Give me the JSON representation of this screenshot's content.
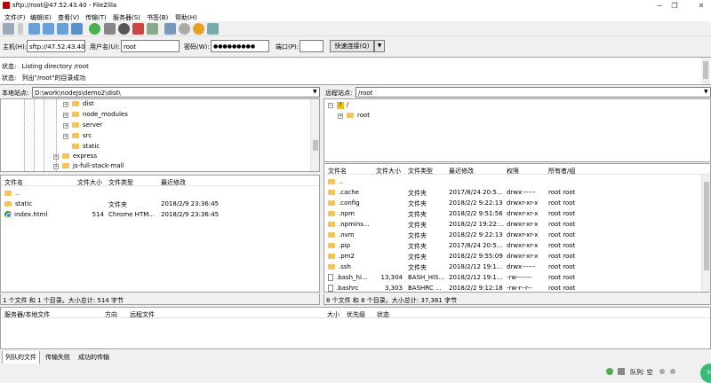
{
  "window": {
    "title": "sftp://root@47.52.43.40 - FileZilla"
  },
  "menu": [
    "文件(F)",
    "编辑(E)",
    "查看(V)",
    "传输(T)",
    "服务器(S)",
    "书签(B)",
    "帮助(H)"
  ],
  "quickconnect": {
    "host_label": "主机(H):",
    "host_value": "sftp://47.52.43.40",
    "user_label": "用户名(U):",
    "user_value": "root",
    "pass_label": "密码(W):",
    "pass_value": "●●●●●●●●●",
    "port_label": "端口(P):",
    "port_value": "",
    "button": "快速连接(Q)",
    "dropdown": "▼"
  },
  "log": [
    {
      "label": "状态:",
      "text": "Listing directory /root"
    },
    {
      "label": "状态:",
      "text": "列出\"/root\"的目录成功"
    }
  ],
  "local": {
    "site_label": "本地站点:",
    "path": "D:\\work\\nodeJs\\demo2\\dist\\",
    "tree": [
      "dist",
      "node_modules",
      "server",
      "src",
      "static",
      "express",
      "js-full-stack-mall"
    ],
    "columns": [
      "文件名",
      "文件大小",
      "文件类型",
      "最近修改"
    ],
    "files": [
      {
        "name": "..",
        "size": "",
        "type": "",
        "modified": ""
      },
      {
        "name": "static",
        "size": "",
        "type": "文件夹",
        "modified": "2018/2/9 23:36:45"
      },
      {
        "name": "index.html",
        "size": "514",
        "type": "Chrome HTM...",
        "modified": "2018/2/9 23:36:45"
      }
    ],
    "status": "1 个文件 和 1 个目录。大小总计: 514 字节"
  },
  "remote": {
    "site_label": "远程站点:",
    "path": "/root",
    "tree": [
      "/",
      "root"
    ],
    "columns": [
      "文件名",
      "文件大小",
      "文件类型",
      "最近修改",
      "权限",
      "所有者/组"
    ],
    "files": [
      {
        "name": "..",
        "size": "",
        "type": "",
        "modified": "",
        "perm": "",
        "owner": ""
      },
      {
        "name": ".cache",
        "size": "",
        "type": "文件夹",
        "modified": "2017/8/24 20:5...",
        "perm": "drwx------",
        "owner": "root root"
      },
      {
        "name": ".config",
        "size": "",
        "type": "文件夹",
        "modified": "2018/2/2 9:22:13",
        "perm": "drwxr-xr-x",
        "owner": "root root"
      },
      {
        "name": ".npm",
        "size": "",
        "type": "文件夹",
        "modified": "2018/2/2 9:51:56",
        "perm": "drwxr-xr-x",
        "owner": "root root"
      },
      {
        "name": ".npmins...",
        "size": "",
        "type": "文件夹",
        "modified": "2018/2/2 19:22:...",
        "perm": "drwxr-xr-x",
        "owner": "root root"
      },
      {
        "name": ".nvm",
        "size": "",
        "type": "文件夹",
        "modified": "2018/2/2 9:22:13",
        "perm": "drwxr-xr-x",
        "owner": "root root"
      },
      {
        "name": ".pip",
        "size": "",
        "type": "文件夹",
        "modified": "2017/8/24 20:5...",
        "perm": "drwxr-xr-x",
        "owner": "root root"
      },
      {
        "name": ".pm2",
        "size": "",
        "type": "文件夹",
        "modified": "2018/2/2 9:55:09",
        "perm": "drwxr-xr-x",
        "owner": "root root"
      },
      {
        "name": ".ssh",
        "size": "",
        "type": "文件夹",
        "modified": "2018/2/12 19:1...",
        "perm": "drwx------",
        "owner": "root root"
      },
      {
        "name": ".bash_hi...",
        "size": "13,304",
        "type": "BASH_HIS...",
        "modified": "2018/2/12 19:1...",
        "perm": "-rw-------",
        "owner": "root root"
      },
      {
        "name": ".bashrc",
        "size": "3,303",
        "type": "BASHRC ...",
        "modified": "2018/2/2 9:12:18",
        "perm": "-rw-r--r--",
        "owner": "root root"
      }
    ],
    "status": "8 个文件 和 8 个目录。大小总计: 37,361 字节"
  },
  "queue": {
    "columns": [
      "服务器/本地文件",
      "方向",
      "远程文件",
      "大小",
      "优先级",
      "状态"
    ],
    "tabs": [
      "列队的文件",
      "传输失败",
      "成功的传输"
    ],
    "status_text": "队列: 空",
    "badge": "56"
  }
}
